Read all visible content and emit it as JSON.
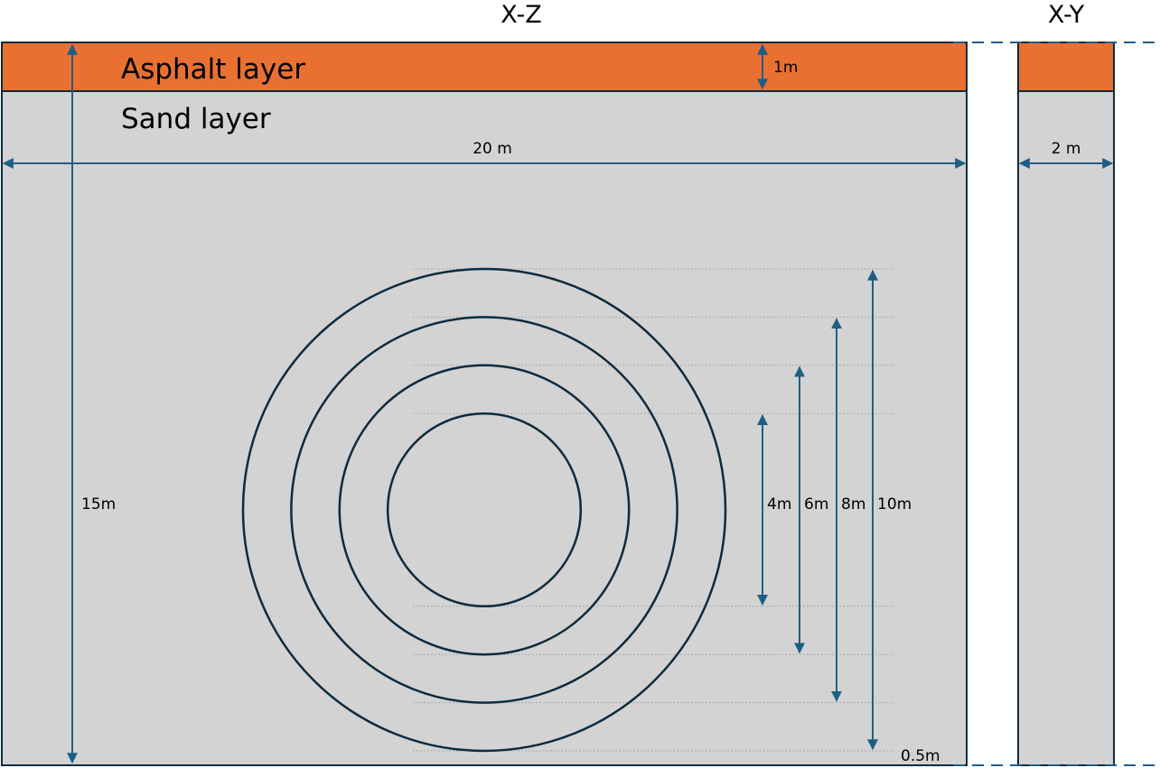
{
  "views": {
    "xz_title": "X-Z",
    "xy_title": "X-Y"
  },
  "layers": {
    "asphalt": {
      "label": "Asphalt layer",
      "thickness_label": "1m"
    },
    "sand": {
      "label": "Sand layer"
    }
  },
  "dimensions": {
    "width_xz": "20 m",
    "width_xy": "2 m",
    "depth": "15m",
    "bottom_gap": "0.5m"
  },
  "rings": [
    {
      "diameter_m": 4,
      "label": "4m"
    },
    {
      "diameter_m": 6,
      "label": "6m"
    },
    {
      "diameter_m": 8,
      "label": "8m"
    },
    {
      "diameter_m": 10,
      "label": "10m"
    }
  ],
  "colors": {
    "asphalt": "#E87131",
    "sand": "#D3D3D3",
    "outline": "#0E2B3E",
    "arrow": "#1F5E84",
    "guide": "#A9A9A9"
  }
}
